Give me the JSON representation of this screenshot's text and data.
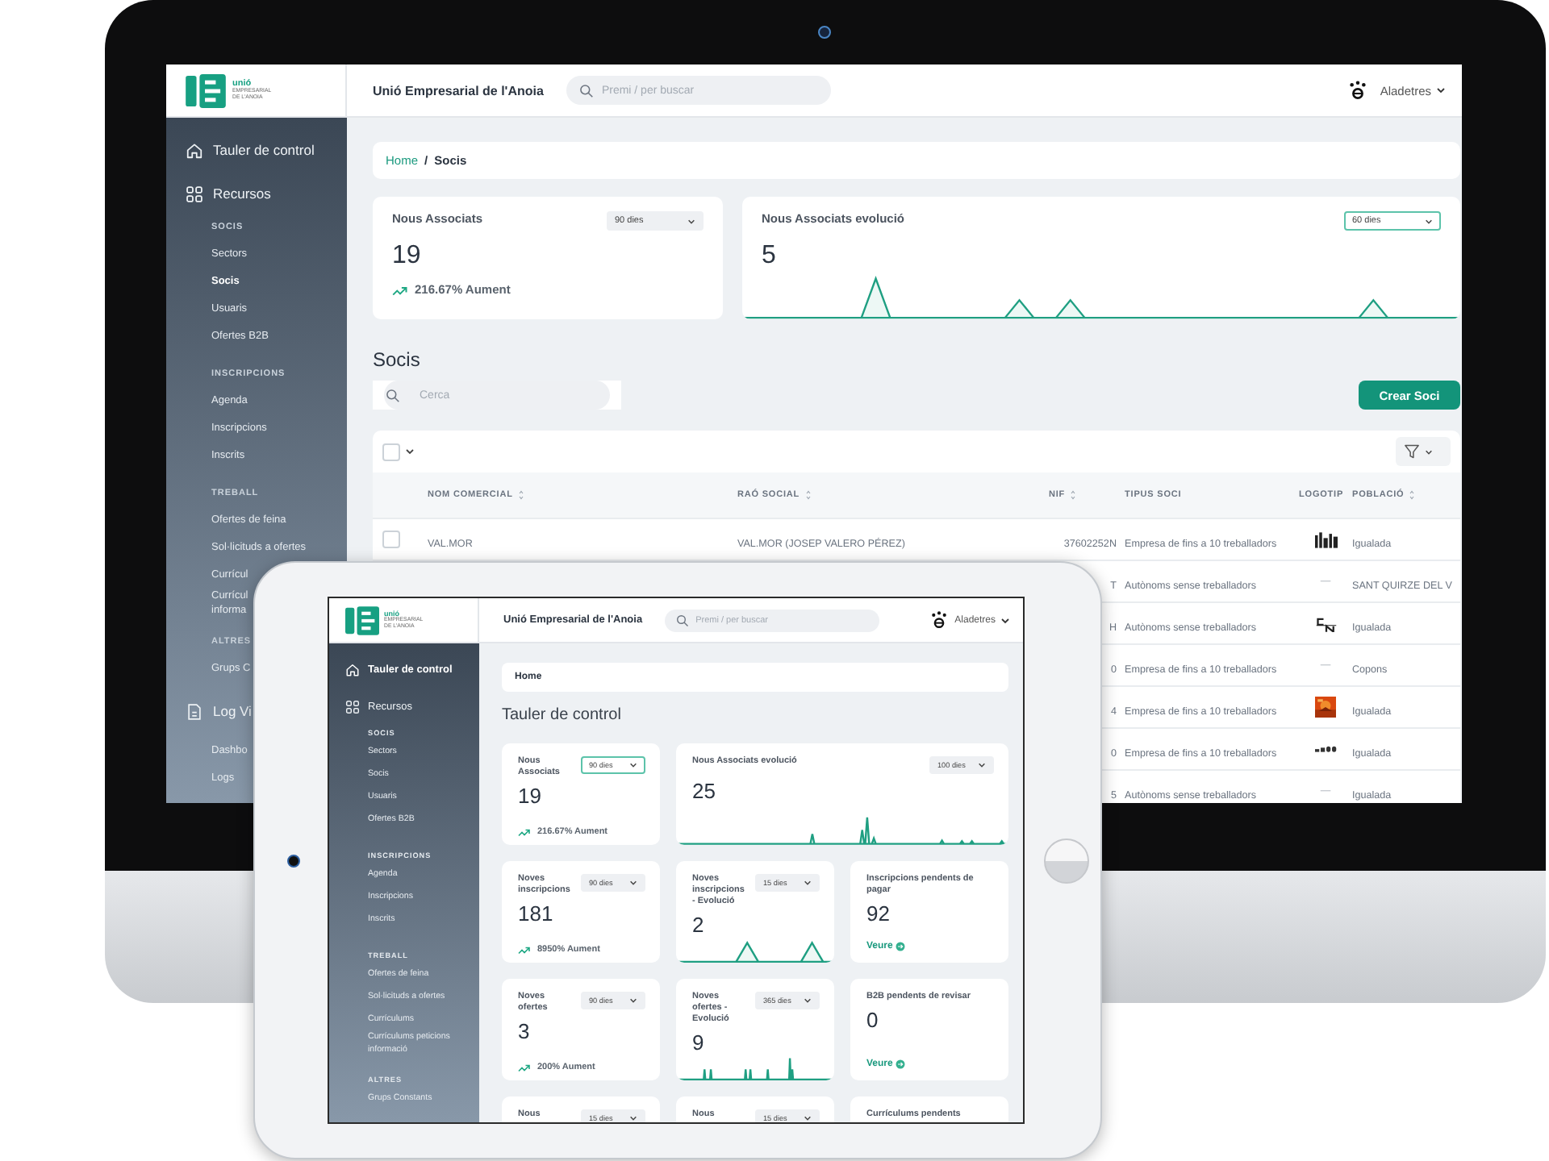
{
  "desktop_screen": {
    "logo": {
      "name": "unió",
      "lines": [
        "EMPRESARIAL",
        "DE L'ANOIA"
      ]
    },
    "header": {
      "title": "Unió Empresarial de l'Anoia",
      "search": {
        "placeholder": "Premi / per buscar"
      },
      "user": "Aladetres"
    },
    "sidebar": [
      {
        "kind": "top",
        "label": "Tauler de control",
        "selected": false
      },
      {
        "kind": "top",
        "label": "Recursos",
        "selected": false,
        "children": [
          {
            "kind": "heading",
            "label": "SOCIS"
          },
          {
            "kind": "item",
            "label": "Sectors",
            "selected": false
          },
          {
            "kind": "item",
            "label": "Socis",
            "selected": true
          },
          {
            "kind": "item",
            "label": "Usuaris",
            "selected": false
          },
          {
            "kind": "item",
            "label": "Ofertes B2B",
            "selected": false
          },
          {
            "kind": "heading",
            "label": "INSCRIPCIONS"
          },
          {
            "kind": "item",
            "label": "Agenda",
            "selected": false
          },
          {
            "kind": "item",
            "label": "Inscripcions",
            "selected": false
          },
          {
            "kind": "item",
            "label": "Inscrits",
            "selected": false
          },
          {
            "kind": "heading",
            "label": "TREBALL"
          },
          {
            "kind": "item",
            "label": "Ofertes de feina",
            "selected": false
          },
          {
            "kind": "item",
            "label": "Sol·licituds a ofertes",
            "selected": false
          },
          {
            "kind": "item",
            "label": "Currícul",
            "selected": false
          },
          {
            "kind": "item",
            "label": "Currícul\ninforma",
            "selected": false
          },
          {
            "kind": "heading",
            "label": "ALTRES"
          },
          {
            "kind": "item",
            "label": "Grups C",
            "selected": false
          }
        ]
      },
      {
        "kind": "top",
        "label": "Log Vi",
        "selected": false,
        "children": [
          {
            "kind": "item",
            "label": "Dashbo",
            "selected": false
          },
          {
            "kind": "item",
            "label": "Logs",
            "selected": false
          }
        ]
      }
    ],
    "breadcrumb": [
      {
        "kind": "link",
        "label": "Home"
      },
      {
        "kind": "separator",
        "label": "/"
      },
      {
        "kind": "current",
        "label": "Socis"
      }
    ],
    "cards": [
      {
        "kind": "stat",
        "title": "Nous Associats",
        "period": {
          "label": "90 dies",
          "focused": false
        },
        "value": "19",
        "trend": "216.67% Aument"
      },
      {
        "kind": "evolution",
        "title": "Nous Associats evolució",
        "period": {
          "label": "60 dies",
          "focused": true
        },
        "value": "5"
      }
    ],
    "section_title": "Socis",
    "search": {
      "placeholder": "Cerca"
    },
    "create_button": "Crear Soci",
    "table": {
      "select_all": {
        "checked": false
      },
      "columns": [
        {
          "label": "NOM COMERCIAL",
          "sortable": true
        },
        {
          "label": "RAÓ SOCIAL",
          "sortable": true
        },
        {
          "label": "NIF",
          "sortable": true
        },
        {
          "label": "TIPUS SOCI",
          "sortable": false
        },
        {
          "label": "LOGOTIP",
          "sortable": false
        },
        {
          "label": "POBLACIÓ",
          "sortable": true
        }
      ],
      "rows": [
        {
          "checked": false,
          "name": "VAL.MOR",
          "legal_name": "VAL.MOR (JOSEP VALERO PÉREZ)",
          "nif": "37602252N",
          "type": "Empresa de fins a 10 treballadors",
          "logo": {
            "kind": "mark"
          },
          "town": "Igualada"
        },
        {
          "nif": "T",
          "type": "Autònoms sense treballadors",
          "logo": {
            "kind": "text",
            "text": "—"
          },
          "town": "SANT QUIRZE DEL V"
        },
        {
          "nif": "H",
          "type": "Autònoms sense treballadors",
          "logo": {
            "kind": "letters"
          },
          "town": "Igualada"
        },
        {
          "nif": "0",
          "type": "Empresa de fins a 10 treballadors",
          "logo": {
            "kind": "text",
            "text": "—"
          },
          "town": "Copons"
        },
        {
          "nif": "4",
          "type": "Empresa de fins a 10 treballadors",
          "town": "Igualada"
        },
        {
          "nif": "0",
          "type": "Empresa de fins a 10 treballadors",
          "logo": {
            "kind": "wordmark"
          },
          "town": "Igualada"
        },
        {
          "nif": "5",
          "type": "Autònoms sense treballadors",
          "logo": {
            "kind": "text",
            "text": "—"
          },
          "town": "Igualada"
        }
      ]
    }
  },
  "tablet_screen": {
    "logo": {
      "name": "unió",
      "lines": [
        "EMPRESARIAL",
        "DE L'ANOIA"
      ]
    },
    "header": {
      "title": "Unió Empresarial de l'Anoia",
      "search": {
        "placeholder": "Premi / per buscar"
      },
      "user": "Aladetres"
    },
    "sidebar": [
      {
        "kind": "top",
        "label": "Tauler de control",
        "selected": true
      },
      {
        "kind": "top",
        "label": "Recursos",
        "selected": false,
        "children": [
          {
            "kind": "heading",
            "label": "SOCIS"
          },
          {
            "kind": "item",
            "label": "Sectors",
            "selected": false
          },
          {
            "kind": "item",
            "label": "Socis",
            "selected": false
          },
          {
            "kind": "item",
            "label": "Usuaris",
            "selected": false
          },
          {
            "kind": "item",
            "label": "Ofertes B2B",
            "selected": false
          },
          {
            "kind": "heading",
            "label": "INSCRIPCIONS"
          },
          {
            "kind": "item",
            "label": "Agenda",
            "selected": false
          },
          {
            "kind": "item",
            "label": "Inscripcions",
            "selected": false
          },
          {
            "kind": "item",
            "label": "Inscrits",
            "selected": false
          },
          {
            "kind": "heading",
            "label": "TREBALL"
          },
          {
            "kind": "item",
            "label": "Ofertes de feina",
            "selected": false
          },
          {
            "kind": "item",
            "label": "Sol·licituds a ofertes",
            "selected": false
          },
          {
            "kind": "item",
            "label": "Currículums",
            "selected": false
          },
          {
            "kind": "item",
            "label": "Currículums peticions\ninformació",
            "selected": false
          },
          {
            "kind": "heading",
            "label": "ALTRES"
          },
          {
            "kind": "item",
            "label": "Grups Constants",
            "selected": false
          }
        ]
      }
    ],
    "breadcrumb": [
      {
        "kind": "current",
        "label": "Home"
      }
    ],
    "page_title": "Tauler de control",
    "cards": [
      {
        "kind": "stat",
        "title": "Nous Associats",
        "period": {
          "label": "90 dies",
          "focused": true
        },
        "value": "19",
        "trend": "216.67% Aument"
      },
      {
        "kind": "evolution",
        "title": "Nous Associats evolució",
        "period": {
          "label": "100 dies",
          "focused": false
        },
        "value": "25",
        "wide": true
      },
      {
        "kind": "stat",
        "title": "Noves inscripcions",
        "period": {
          "label": "90 dies",
          "focused": false
        },
        "value": "181",
        "trend": "8950% Aument"
      },
      {
        "kind": "evolution",
        "title": "Noves inscripcions - Evolució",
        "period": {
          "label": "15 dies",
          "focused": false
        },
        "value": "2"
      },
      {
        "kind": "pending",
        "title": "Inscripcions pendents de pagar",
        "value": "92",
        "link": "Veure"
      },
      {
        "kind": "stat",
        "title": "Noves ofertes",
        "period": {
          "label": "90 dies",
          "focused": false
        },
        "value": "3",
        "trend": "200% Aument"
      },
      {
        "kind": "evolution",
        "title": "Noves ofertes - Evolució",
        "period": {
          "label": "365 dies",
          "focused": false
        },
        "value": "9"
      },
      {
        "kind": "pending",
        "title": "B2B pendents de revisar",
        "value": "0",
        "link": "Veure"
      },
      {
        "kind": "stat",
        "title": "Nous",
        "period": {
          "label": "15 dies",
          "focused": false
        }
      },
      {
        "kind": "evolution",
        "title": "Nous",
        "period": {
          "label": "15 dies",
          "focused": false
        }
      },
      {
        "kind": "pending",
        "title": "Currículums pendents"
      }
    ]
  }
}
